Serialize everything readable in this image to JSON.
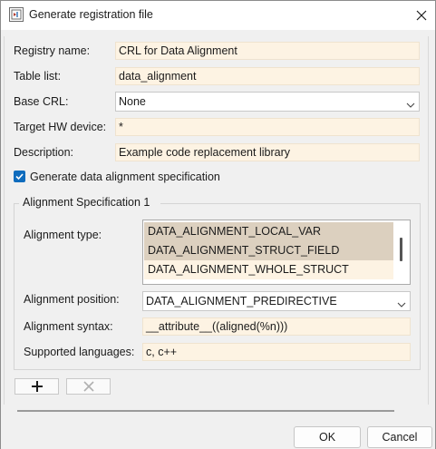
{
  "window": {
    "title": "Generate registration file",
    "app_icon": "simulink-app-icon",
    "close_icon": "close-icon"
  },
  "form": {
    "registry_name": {
      "label": "Registry name:",
      "value": "CRL for Data Alignment"
    },
    "table_list": {
      "label": "Table list:",
      "value": "data_alignment"
    },
    "base_crl": {
      "label": "Base CRL:",
      "value": "None"
    },
    "target_hw": {
      "label": "Target HW device:",
      "value": "*"
    },
    "description": {
      "label": "Description:",
      "value": "Example code replacement library"
    },
    "generate_alignment": {
      "label": "Generate data alignment specification",
      "checked": true
    }
  },
  "alignment_spec": {
    "group_title": "Alignment Specification 1",
    "type": {
      "label": "Alignment type:",
      "items": [
        {
          "text": "DATA_ALIGNMENT_LOCAL_VAR",
          "selected": true
        },
        {
          "text": "DATA_ALIGNMENT_STRUCT_FIELD",
          "selected": true
        },
        {
          "text": "DATA_ALIGNMENT_WHOLE_STRUCT",
          "selected": false
        }
      ]
    },
    "position": {
      "label": "Alignment position:",
      "value": "DATA_ALIGNMENT_PREDIRECTIVE"
    },
    "syntax": {
      "label": "Alignment syntax:",
      "value": "__attribute__((aligned(%n)))"
    },
    "languages": {
      "label": "Supported languages:",
      "value": "c, c++"
    }
  },
  "toolbar": {
    "add_icon": "plus-icon",
    "remove_icon": "x-icon"
  },
  "buttons": {
    "ok": "OK",
    "cancel": "Cancel"
  },
  "colors": {
    "field_bg": "#fdf3e3",
    "selected_item_bg": "#dcd0bf",
    "checkbox_accent": "#0f6cbd"
  }
}
